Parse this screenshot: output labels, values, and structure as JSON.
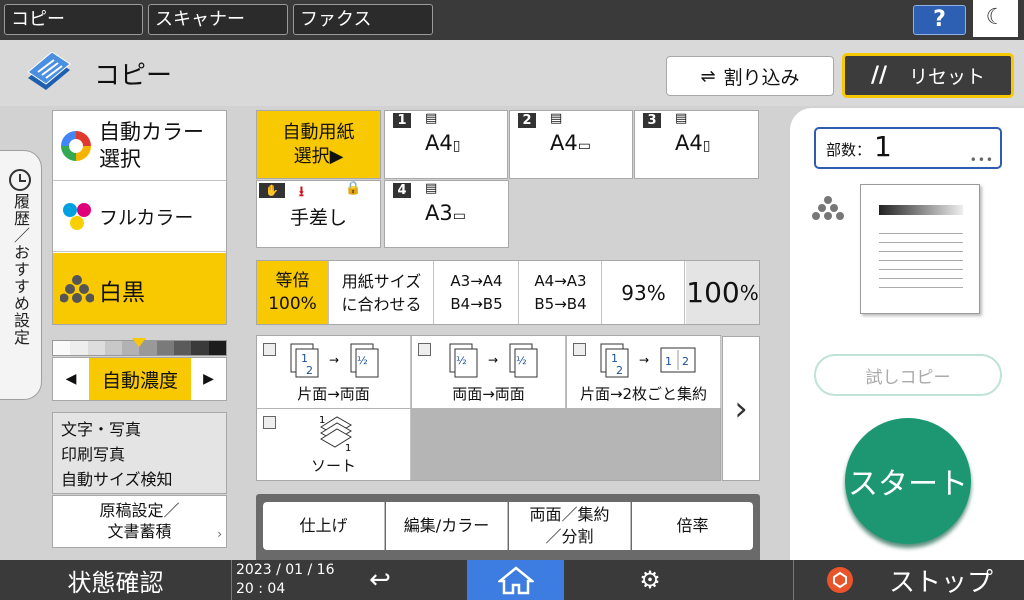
{
  "app_tabs": [
    "コピー",
    "スキャナー",
    "ファクス"
  ],
  "help_label": "?",
  "title": "コピー",
  "buttons": {
    "interrupt": "割り込み",
    "reset": "リセット"
  },
  "history_tab": "履歴／おすすめ設定",
  "color_modes": [
    {
      "label1": "自動カラー",
      "label2": "選択"
    },
    {
      "label1": "フルカラー",
      "label2": ""
    },
    {
      "label1": "白黒",
      "label2": ""
    }
  ],
  "density_label": "自動濃度",
  "original_types": [
    "文字・写真",
    "印刷写真",
    "自動サイズ検知"
  ],
  "original_settings": {
    "line1": "原稿設定／",
    "line2": "文書蓄積"
  },
  "paper": {
    "auto_line1": "自動用紙",
    "auto_line2": "選択▶",
    "trays": [
      {
        "num": "1",
        "size": "A4"
      },
      {
        "num": "2",
        "size": "A4"
      },
      {
        "num": "3",
        "size": "A4"
      },
      {
        "num": "4",
        "size": "A3"
      }
    ],
    "bypass": "手差し"
  },
  "ratios": [
    {
      "line1": "等倍",
      "line2": "100%"
    },
    {
      "line1": "用紙サイズ",
      "line2": "に合わせる"
    },
    {
      "line1": "A3→A4",
      "line2": "B4→B5"
    },
    {
      "line1": "A4→A3",
      "line2": "B5→B4"
    },
    {
      "line1": "93%",
      "line2": ""
    },
    {
      "line1": "100",
      "line2": "%"
    }
  ],
  "modes": [
    "片面→両面",
    "両面→両面",
    "片面→2枚ごと集約",
    "ソート"
  ],
  "bottom_tabs": [
    "仕上げ",
    "編集/カラー",
    "両面／集約／分割",
    "倍率"
  ],
  "copies": {
    "label": "部数：",
    "value": "1"
  },
  "trial_copy": "試しコピー",
  "start": "スタート",
  "status_label": "状態確認",
  "date": "2023 / 01 / 16",
  "time": "20 : 04",
  "stop": "ストップ"
}
